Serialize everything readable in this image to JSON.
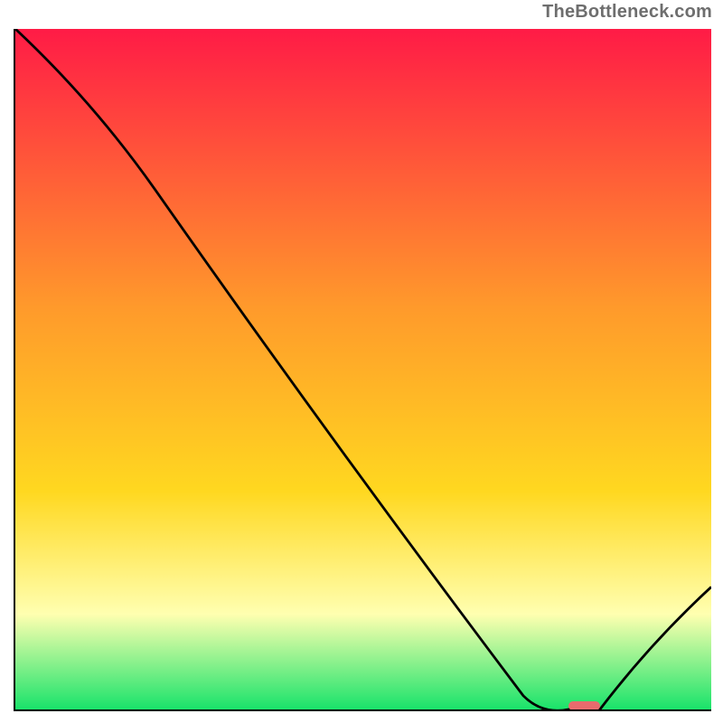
{
  "watermark": "TheBottleneck.com",
  "colors": {
    "grad_top": "#ff1b46",
    "grad_mid1": "#ff6a2f",
    "grad_mid2": "#ffd820",
    "grad_pale": "#ffffb0",
    "grad_bottom": "#19e36a",
    "curve": "#000000",
    "marker": "#e86b6d"
  },
  "chart_data": {
    "type": "line",
    "title": "",
    "xlabel": "",
    "ylabel": "",
    "xlim": [
      0,
      100
    ],
    "ylim": [
      0,
      100
    ],
    "x": [
      0,
      20,
      73,
      79.5,
      84,
      100
    ],
    "values": [
      100,
      76.5,
      2,
      0,
      0,
      18
    ],
    "marker": {
      "x_start": 79.5,
      "x_end": 84,
      "y": 0
    },
    "annotations": []
  }
}
